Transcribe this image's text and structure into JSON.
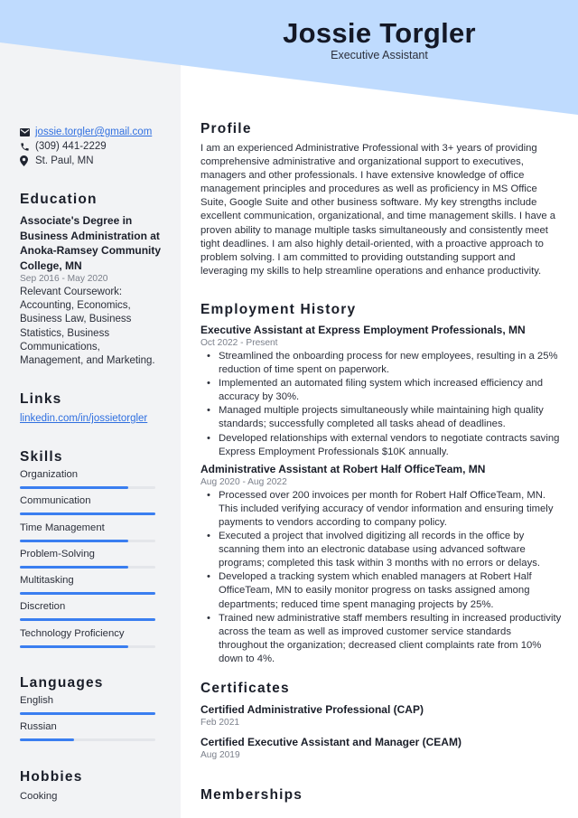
{
  "header": {
    "name": "Jossie Torgler",
    "title": "Executive Assistant",
    "accent_color": "#bfdbfe"
  },
  "contact": {
    "email": "jossie.torgler@gmail.com",
    "phone": "(309) 441-2229",
    "location": "St. Paul, MN",
    "icons": [
      "envelope-icon",
      "phone-icon",
      "map-pin-icon"
    ]
  },
  "education": {
    "heading": "Education",
    "degree": "Associate's Degree in Business Administration at Anoka-Ramsey Community College, MN",
    "dates": "Sep 2016 - May 2020",
    "coursework": "Relevant Coursework: Accounting, Economics, Business Law, Business Statistics, Business Communications, Management, and Marketing."
  },
  "links": {
    "heading": "Links",
    "items": [
      "linkedin.com/in/jossietorgler"
    ]
  },
  "skills": {
    "heading": "Skills",
    "bar_color": "#3a7ef0",
    "items": [
      {
        "name": "Organization",
        "level": 0.8
      },
      {
        "name": "Communication",
        "level": 1.0
      },
      {
        "name": "Time Management",
        "level": 0.8
      },
      {
        "name": "Problem-Solving",
        "level": 0.8
      },
      {
        "name": "Multitasking",
        "level": 1.0
      },
      {
        "name": "Discretion",
        "level": 1.0
      },
      {
        "name": "Technology Proficiency",
        "level": 0.8
      }
    ]
  },
  "languages": {
    "heading": "Languages",
    "items": [
      {
        "name": "English",
        "level": 1.0
      },
      {
        "name": "Russian",
        "level": 0.4
      }
    ]
  },
  "hobbies": {
    "heading": "Hobbies",
    "items": [
      "Cooking"
    ]
  },
  "profile": {
    "heading": "Profile",
    "text": "I am an experienced Administrative Professional with 3+ years of providing comprehensive administrative and organizational support to executives, managers and other professionals. I have extensive knowledge of office management principles and procedures as well as proficiency in MS Office Suite, Google Suite and other business software. My key strengths include excellent communication, organizational, and time management skills. I have a proven ability to manage multiple tasks simultaneously and consistently meet tight deadlines. I am also highly detail-oriented, with a proactive approach to problem solving. I am committed to providing outstanding support and leveraging my skills to help streamline operations and enhance productivity."
  },
  "employment": {
    "heading": "Employment History",
    "jobs": [
      {
        "title": "Executive Assistant at Express Employment Professionals, MN",
        "dates": "Oct 2022 - Present",
        "bullets": [
          "Streamlined the onboarding process for new employees, resulting in a 25% reduction of time spent on paperwork.",
          "Implemented an automated filing system which increased efficiency and accuracy by 30%.",
          "Managed multiple projects simultaneously while maintaining high quality standards; successfully completed all tasks ahead of deadlines.",
          "Developed relationships with external vendors to negotiate contracts saving Express Employment Professionals $10K annually."
        ]
      },
      {
        "title": "Administrative Assistant at Robert Half OfficeTeam, MN",
        "dates": "Aug 2020 - Aug 2022",
        "bullets": [
          "Processed over 200 invoices per month for Robert Half OfficeTeam, MN. This included verifying accuracy of vendor information and ensuring timely payments to vendors according to company policy.",
          "Executed a project that involved digitizing all records in the office by scanning them into an electronic database using advanced software programs; completed this task within 3 months with no errors or delays.",
          "Developed a tracking system which enabled managers at Robert Half OfficeTeam, MN to easily monitor progress on tasks assigned among departments; reduced time spent managing projects by 25%.",
          "Trained new administrative staff members resulting in increased productivity across the team as well as improved customer service standards throughout the organization; decreased client complaints rate from 10% down to 4%."
        ]
      }
    ]
  },
  "certificates": {
    "heading": "Certificates",
    "items": [
      {
        "title": "Certified Administrative Professional (CAP)",
        "date": "Feb 2021"
      },
      {
        "title": "Certified Executive Assistant and Manager (CEAM)",
        "date": "Aug 2019"
      }
    ]
  },
  "memberships": {
    "heading": "Memberships"
  }
}
